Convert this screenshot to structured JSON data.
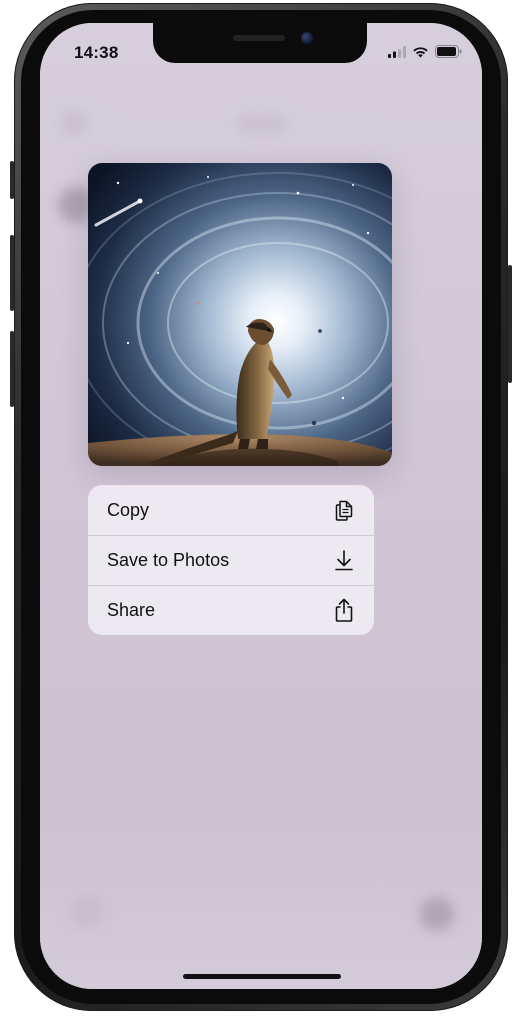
{
  "status_bar": {
    "time": "14:38",
    "icons": [
      "cellular-signal-icon",
      "wifi-icon",
      "battery-icon"
    ]
  },
  "preview": {
    "description_icon": "image-preview"
  },
  "context_menu": {
    "items": [
      {
        "label": "Copy",
        "icon": "copy-icon"
      },
      {
        "label": "Save to Photos",
        "icon": "download-icon"
      },
      {
        "label": "Share",
        "icon": "share-icon"
      }
    ]
  },
  "colors": {
    "screen_background": "#d1c8d6",
    "menu_background": "#f0ecf3",
    "text": "#111111"
  }
}
